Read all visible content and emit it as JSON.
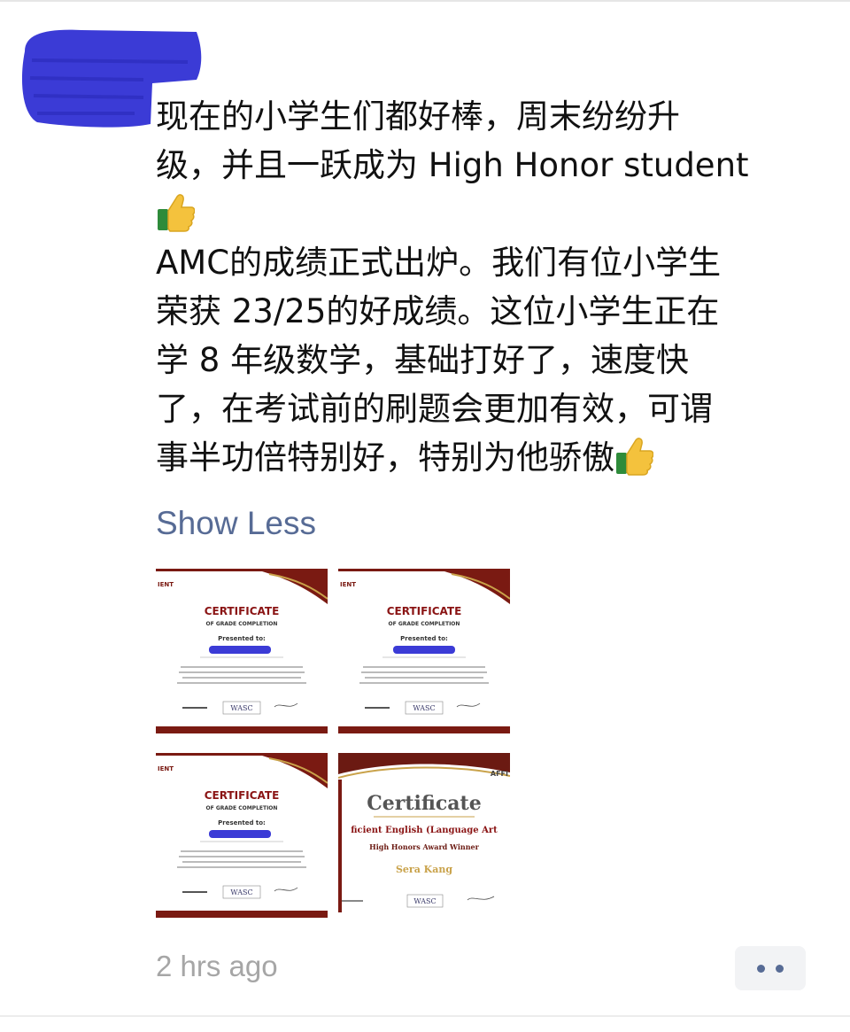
{
  "post": {
    "lines": [
      "现在的小学生们都好棒，周末纷纷升",
      "级，并且一跃成为 High Honor student",
      "",
      "AMC的成绩正式出炉。我们有位小学生",
      "荣获 23/25的好成绩。这位小学生正在",
      "学 8 年级数学，基础打好了，速度快",
      "了，在考试前的刷题会更加有效，可谓",
      "事半功倍特别好，特别为他骄傲"
    ],
    "show_less": "Show Less",
    "timestamp": "2 hrs ago"
  },
  "certificates": [
    {
      "corner": "IENT",
      "title": "CERTIFICATE",
      "subtitle": "OF GRADE COMPLETION",
      "presented": "Presented to:",
      "logo": "WASC"
    },
    {
      "corner": "IENT",
      "title": "CERTIFICATE",
      "subtitle": "OF GRADE COMPLETION",
      "presented": "Presented to:",
      "logo": "WASC"
    },
    {
      "corner": "IENT",
      "title": "CERTIFICATE",
      "subtitle": "OF GRADE COMPLETION",
      "presented": "Presented to:",
      "logo": "WASC"
    },
    {
      "corner": "AFFI",
      "title": "Certificate",
      "line1": "ficient English (Language Art",
      "line2": "High Honors Award Winner",
      "name": "Sera Kang",
      "logo": "WASC"
    }
  ],
  "colors": {
    "link": "#576b95",
    "redaction": "#3b3bd6",
    "certificate_title": "#8a1414",
    "certificate_border": "#7a1a12"
  },
  "icons": [
    "thumbs-up-icon",
    "more-dots-icon"
  ]
}
